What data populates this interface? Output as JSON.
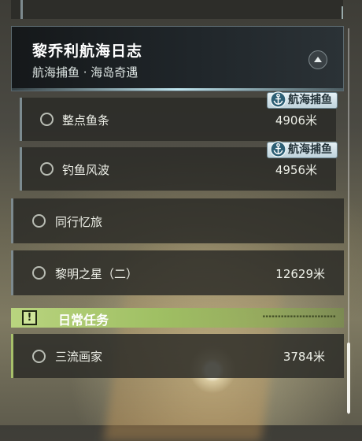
{
  "journal": {
    "title": "黎乔利航海日志",
    "subtitle": "航海捕鱼 · 海岛奇遇",
    "collapse_icon": "chevron-up-icon"
  },
  "sub_quests": [
    {
      "name": "整点鱼条",
      "distance": "4906米",
      "tag": "航海捕鱼",
      "tag_icon": "anchor-icon"
    },
    {
      "name": "钓鱼风波",
      "distance": "4956米",
      "tag": "航海捕鱼",
      "tag_icon": "anchor-icon"
    }
  ],
  "quests": [
    {
      "name": "同行忆旅",
      "distance": ""
    },
    {
      "name": "黎明之星（二）",
      "distance": "12629米"
    }
  ],
  "daily_section": {
    "label": "日常任务",
    "icon": "exclamation-icon",
    "accent": "#a7c06a",
    "items": [
      {
        "name": "三流画家",
        "distance": "3784米"
      }
    ]
  },
  "colors": {
    "row_bg": "#2a2a26",
    "row_accent": "#7d8a8e",
    "tag_bg": "#d8e6ec"
  }
}
